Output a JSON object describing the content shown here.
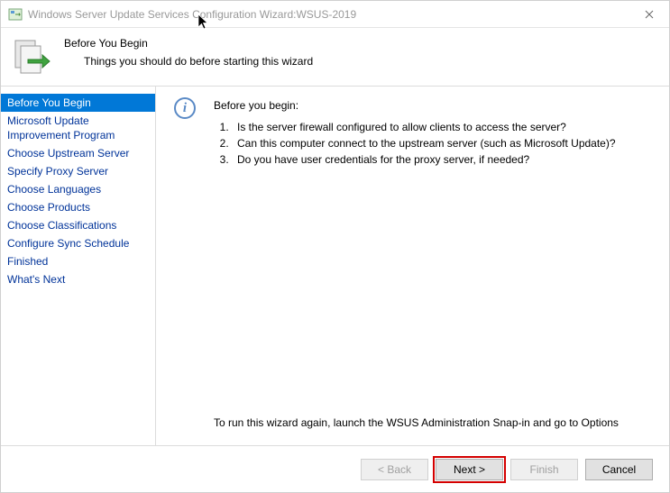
{
  "window": {
    "title": "Windows Server Update Services Configuration Wizard:WSUS-2019"
  },
  "header": {
    "title": "Before You Begin",
    "subtitle": "Things you should do before starting this wizard"
  },
  "sidebar": {
    "steps": [
      "Before You Begin",
      "Microsoft Update Improvement Program",
      "Choose Upstream Server",
      "Specify Proxy Server",
      "Choose Languages",
      "Choose Products",
      "Choose Classifications",
      "Configure Sync Schedule",
      "Finished",
      "What's Next"
    ],
    "selected_index": 0
  },
  "content": {
    "intro": "Before you begin:",
    "items": [
      "Is the server firewall configured to allow clients to access the server?",
      "Can this computer connect to the upstream server (such as Microsoft Update)?",
      "Do you have user credentials for the proxy server, if needed?"
    ],
    "footer": "To run this wizard again, launch the WSUS Administration Snap-in and go to Options"
  },
  "buttons": {
    "back": "< Back",
    "next": "Next >",
    "finish": "Finish",
    "cancel": "Cancel"
  }
}
